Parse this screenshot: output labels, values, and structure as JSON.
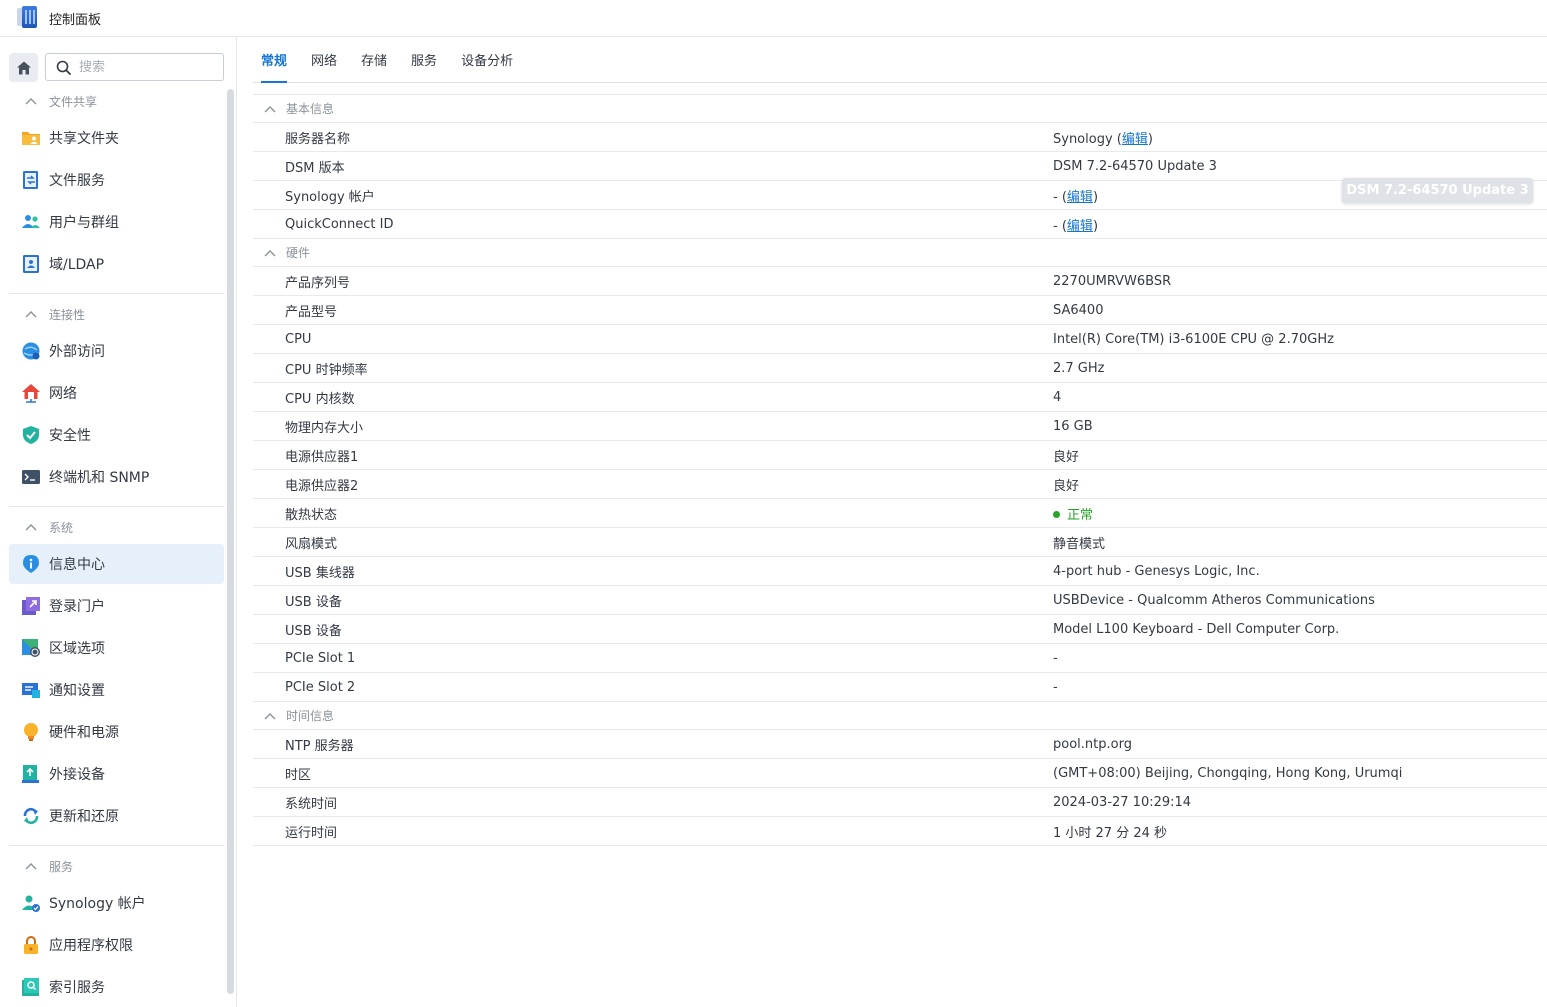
{
  "window": {
    "title": "控制面板"
  },
  "sidebar": {
    "search_placeholder": "搜索",
    "sections": [
      {
        "label": "文件共享",
        "items": [
          {
            "label": "共享文件夹",
            "icon": "folder-user-icon"
          },
          {
            "label": "文件服务",
            "icon": "file-services-icon"
          },
          {
            "label": "用户与群组",
            "icon": "users-group-icon"
          },
          {
            "label": "域/LDAP",
            "icon": "ldap-icon"
          }
        ]
      },
      {
        "label": "连接性",
        "items": [
          {
            "label": "外部访问",
            "icon": "external-access-icon"
          },
          {
            "label": "网络",
            "icon": "network-house-icon"
          },
          {
            "label": "安全性",
            "icon": "shield-check-icon"
          },
          {
            "label": "终端机和 SNMP",
            "icon": "terminal-icon"
          }
        ]
      },
      {
        "label": "系统",
        "items": [
          {
            "label": "信息中心",
            "icon": "info-icon",
            "active": true
          },
          {
            "label": "登录门户",
            "icon": "login-portal-icon"
          },
          {
            "label": "区域选项",
            "icon": "regional-map-icon"
          },
          {
            "label": "通知设置",
            "icon": "notification-icon"
          },
          {
            "label": "硬件和电源",
            "icon": "lightbulb-icon"
          },
          {
            "label": "外接设备",
            "icon": "external-device-icon"
          },
          {
            "label": "更新和还原",
            "icon": "update-restore-icon"
          }
        ]
      },
      {
        "label": "服务",
        "items": [
          {
            "label": "Synology 帐户",
            "icon": "synology-account-icon"
          },
          {
            "label": "应用程序权限",
            "icon": "lock-icon"
          },
          {
            "label": "索引服务",
            "icon": "index-search-icon"
          }
        ]
      }
    ]
  },
  "tabs": [
    {
      "label": "常规",
      "active": true
    },
    {
      "label": "网络"
    },
    {
      "label": "存储"
    },
    {
      "label": "服务"
    },
    {
      "label": "设备分析"
    }
  ],
  "info": {
    "edit_label": "编辑",
    "groups": [
      {
        "label": "基本信息",
        "rows": [
          {
            "key": "服务器名称",
            "value": "Synology",
            "edit": true
          },
          {
            "key": "DSM 版本",
            "value": "DSM 7.2-64570 Update 3"
          },
          {
            "key": "Synology 帐户",
            "value": "-",
            "edit": true
          },
          {
            "key": "QuickConnect ID",
            "value": "-",
            "edit": true
          }
        ]
      },
      {
        "label": "硬件",
        "rows": [
          {
            "key": "产品序列号",
            "value": "2270UMRVW6BSR"
          },
          {
            "key": "产品型号",
            "value": "SA6400"
          },
          {
            "key": "CPU",
            "value": "Intel(R) Core(TM) i3-6100E CPU @ 2.70GHz"
          },
          {
            "key": "CPU 时钟频率",
            "value": "2.7 GHz"
          },
          {
            "key": "CPU 内核数",
            "value": "4"
          },
          {
            "key": "物理内存大小",
            "value": "16 GB"
          },
          {
            "key": "电源供应器1",
            "value": "良好"
          },
          {
            "key": "电源供应器2",
            "value": "良好"
          },
          {
            "key": "散热状态",
            "value": "正常",
            "status": "ok"
          },
          {
            "key": "风扇模式",
            "value": "静音模式"
          },
          {
            "key": "USB 集线器",
            "value": "4-port hub - Genesys Logic, Inc."
          },
          {
            "key": "USB 设备",
            "value": "USBDevice - Qualcomm Atheros Communications"
          },
          {
            "key": "USB 设备",
            "value": "Model L100 Keyboard - Dell Computer Corp."
          },
          {
            "key": "PCIe Slot 1",
            "value": "-"
          },
          {
            "key": "PCIe Slot 2",
            "value": "-"
          }
        ]
      },
      {
        "label": "时间信息",
        "rows": [
          {
            "key": "NTP 服务器",
            "value": "pool.ntp.org"
          },
          {
            "key": "时区",
            "value": "(GMT+08:00) Beijing, Chongqing, Hong Kong, Urumqi"
          },
          {
            "key": "系统时间",
            "value": "2024-03-27 10:29:14"
          },
          {
            "key": "运行时间",
            "value": "1 小时 27 分 24 秒"
          }
        ]
      }
    ]
  },
  "tooltip": {
    "text": "DSM 7.2-64570 Update 3"
  },
  "colors": {
    "accent": "#1576d4",
    "ok": "#27a327",
    "active_bg": "#e6f0fb"
  }
}
